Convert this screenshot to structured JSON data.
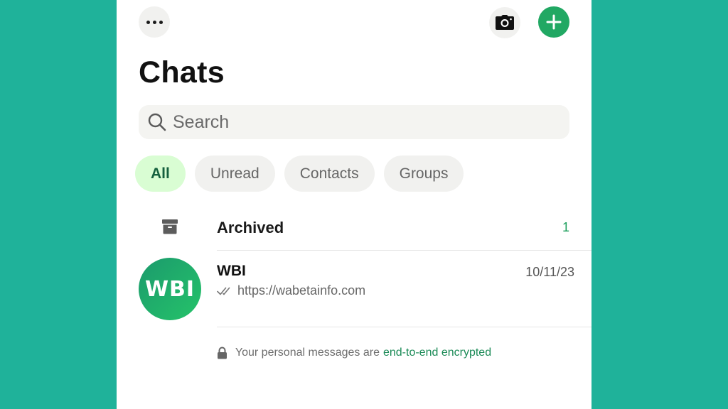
{
  "header": {
    "title": "Chats",
    "more_icon": "more-horizontal-icon",
    "camera_icon": "camera-icon",
    "new_chat_icon": "plus-icon"
  },
  "search": {
    "placeholder": "Search",
    "icon": "search-icon"
  },
  "filters": [
    {
      "label": "All",
      "active": true
    },
    {
      "label": "Unread",
      "active": false
    },
    {
      "label": "Contacts",
      "active": false
    },
    {
      "label": "Groups",
      "active": false
    }
  ],
  "archived": {
    "label": "Archived",
    "count": "1",
    "icon": "archive-icon"
  },
  "chats": [
    {
      "name": "WBI",
      "avatar_text": "WBI",
      "time": "10/11/23",
      "preview": "https://wabetainfo.com",
      "status_icon": "double-check-icon"
    }
  ],
  "encryption_note": {
    "text": "Your personal messages are",
    "link": "end-to-end encrypted",
    "icon": "lock-icon"
  },
  "colors": {
    "background": "#1fb29a",
    "accent": "#21a863",
    "active_chip_bg": "#d9fdd3",
    "active_chip_text": "#15603e",
    "link": "#1a8a56"
  }
}
